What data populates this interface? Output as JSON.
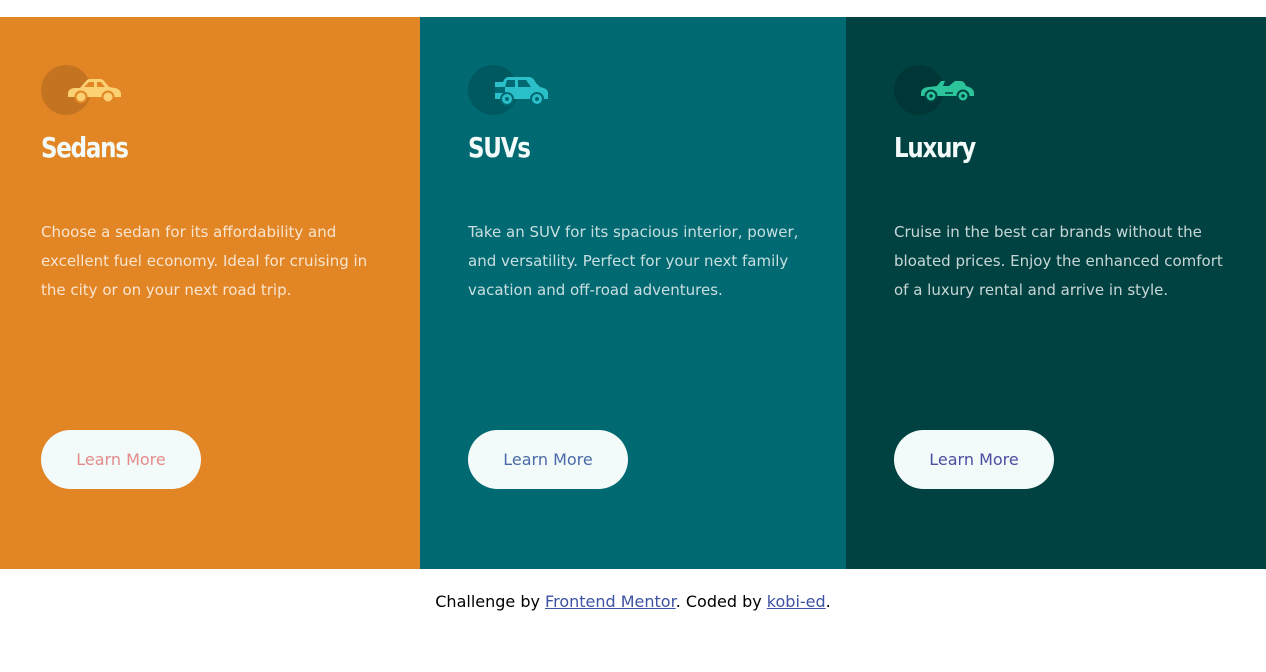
{
  "colors": {
    "sedans_bg": "#e28625",
    "suvs_bg": "#006971",
    "luxury_bg": "#004241",
    "button_bg": "#f3fbfa",
    "sedans_btn_text": "#e38b8b",
    "suvs_btn_text": "#4a6aa8",
    "luxury_btn_text": "#4a4ea0",
    "sedans_icon": "#fbd174",
    "suvs_icon": "#2bbfc9",
    "luxury_icon": "#2bc49b",
    "link": "#3e52a3"
  },
  "cards": [
    {
      "icon": "sedan-car-icon",
      "title": "Sedans",
      "text": "Choose a sedan for its affordability and excellent fuel economy. Ideal for cruising in the city or on your next road trip.",
      "button": "Learn More"
    },
    {
      "icon": "suv-car-icon",
      "title": "SUVs",
      "text": "Take an SUV for its spacious interior, power, and versatility. Perfect for your next family vacation and off-road adventures.",
      "button": "Learn More"
    },
    {
      "icon": "luxury-car-icon",
      "title": "Luxury",
      "text": "Cruise in the best car brands without the bloated prices. Enjoy the enhanced comfort of a luxury rental and arrive in style.",
      "button": "Learn More"
    }
  ],
  "footer": {
    "prefix": "Challenge by ",
    "link1": "Frontend Mentor",
    "middle": ". Coded by ",
    "link2": "kobi-ed",
    "suffix": "."
  }
}
